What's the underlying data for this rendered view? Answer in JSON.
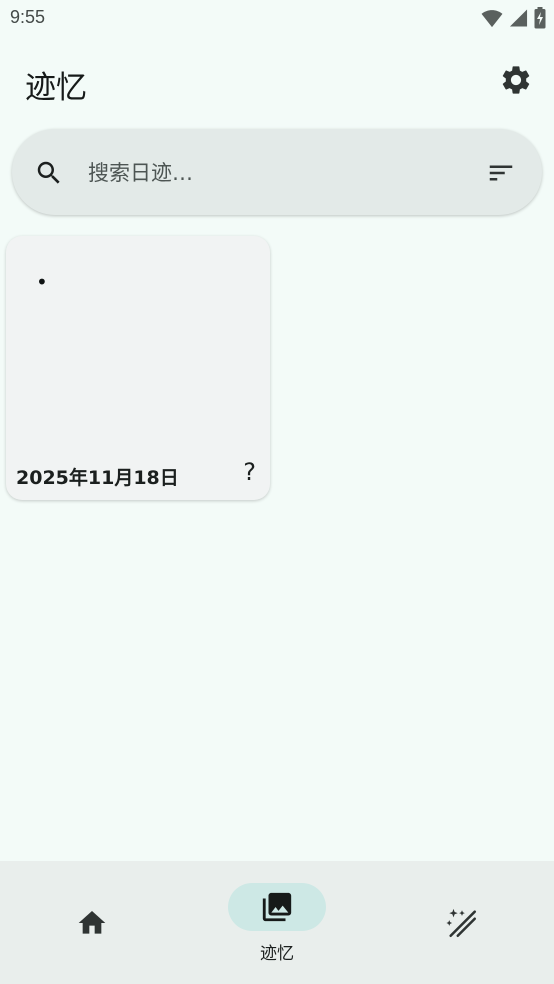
{
  "status_bar": {
    "time": "9:55",
    "icons": [
      "wifi-icon",
      "cellular-signal-icon",
      "battery-charging-icon"
    ]
  },
  "app_bar": {
    "title": "迹忆",
    "settings_icon": "gear-icon"
  },
  "search": {
    "placeholder": "搜索日迹…",
    "value": "",
    "search_icon": "search-icon",
    "sort_icon": "sort-icon"
  },
  "entries": [
    {
      "content": "•",
      "date": "2025年11月18日",
      "mood": "?"
    }
  ],
  "bottom_nav": {
    "items": [
      {
        "icon": "home-icon",
        "label": "",
        "active": false
      },
      {
        "icon": "photo-library-icon",
        "label": "迹忆",
        "active": true
      },
      {
        "icon": "magic-wand-icon",
        "label": "",
        "active": false
      }
    ]
  },
  "colors": {
    "background": "#f3fbf8",
    "search_bar": "#e3eae8",
    "card": "#f1f3f3",
    "nav_bar": "#e9eeec",
    "nav_active_indicator": "#cde8e5",
    "icon_dark": "#2f3433"
  }
}
